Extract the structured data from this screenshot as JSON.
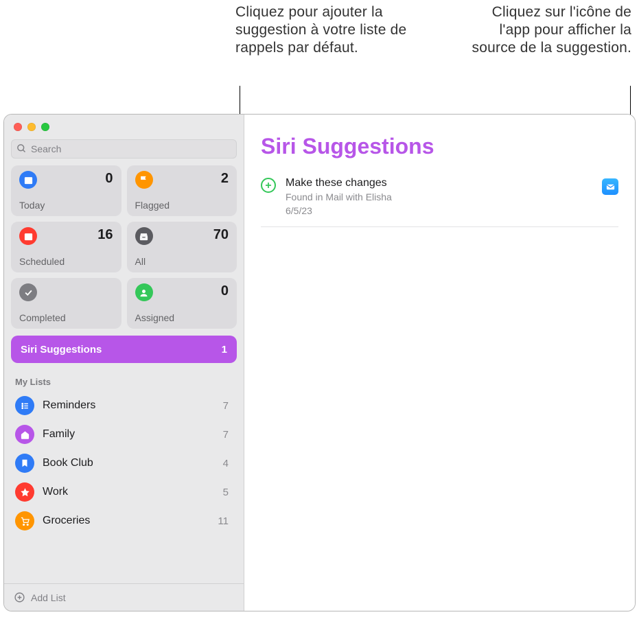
{
  "callouts": {
    "left": "Cliquez pour ajouter la suggestion à votre liste de rappels par défaut.",
    "right": "Cliquez sur l'icône de l'app pour afficher la source de la suggestion."
  },
  "search": {
    "placeholder": "Search"
  },
  "smart": {
    "today": {
      "label": "Today",
      "count": "0",
      "color": "#2f7bf6"
    },
    "flagged": {
      "label": "Flagged",
      "count": "2",
      "color": "#ff9500"
    },
    "scheduled": {
      "label": "Scheduled",
      "count": "16",
      "color": "#ff3b30"
    },
    "all": {
      "label": "All",
      "count": "70",
      "color": "#5b5b60"
    },
    "completed": {
      "label": "Completed",
      "count": "",
      "color": "#7d7d82"
    },
    "assigned": {
      "label": "Assigned",
      "count": "0",
      "color": "#34c759"
    }
  },
  "siri_row": {
    "label": "Siri Suggestions",
    "count": "1"
  },
  "section_title": "My Lists",
  "lists": [
    {
      "name": "Reminders",
      "count": "7",
      "color": "#2f7bf6",
      "icon": "list"
    },
    {
      "name": "Family",
      "count": "7",
      "color": "#b756e8",
      "icon": "home"
    },
    {
      "name": "Book Club",
      "count": "4",
      "color": "#2f7bf6",
      "icon": "bookmark"
    },
    {
      "name": "Work",
      "count": "5",
      "color": "#ff3b30",
      "icon": "star"
    },
    {
      "name": "Groceries",
      "count": "11",
      "color": "#ff9500",
      "icon": "cart"
    }
  ],
  "footer": {
    "add_list": "Add List"
  },
  "main": {
    "title": "Siri Suggestions",
    "suggestion": {
      "title": "Make these changes",
      "subtitle": "Found in Mail with Elisha",
      "date": "6/5/23"
    }
  }
}
